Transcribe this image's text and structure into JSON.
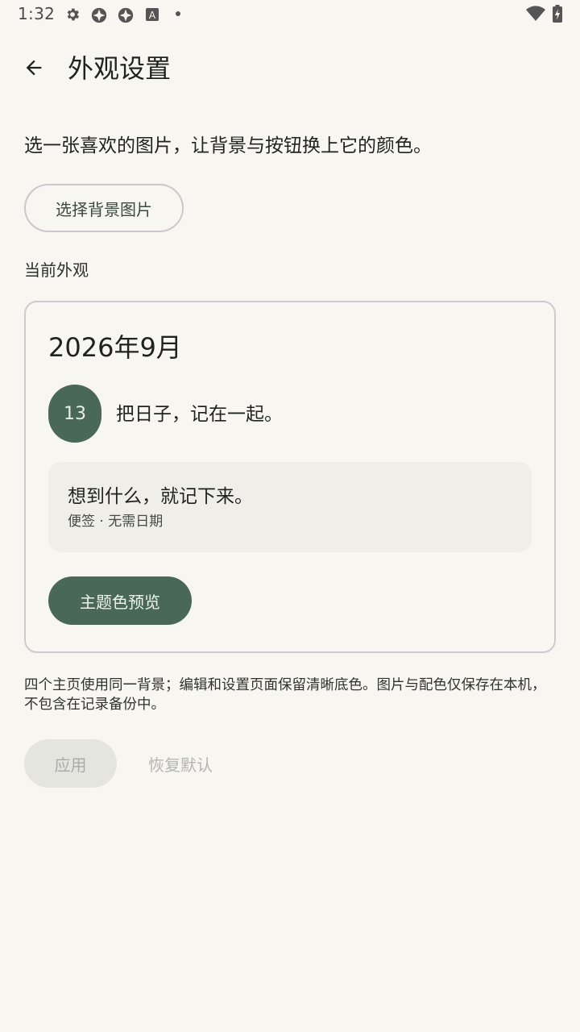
{
  "status_bar": {
    "time": "1:32",
    "icons": [
      "gear-icon",
      "app-icon",
      "app-icon",
      "keyboard-a-icon",
      "dot-icon",
      "wifi-icon",
      "battery-charging-icon"
    ]
  },
  "app_bar": {
    "title": "外观设置",
    "back_icon": "arrow-left-icon"
  },
  "description": "选一张喜欢的图片，让背景与按钮换上它的颜色。",
  "pick_image_button": "选择背景图片",
  "current_appearance_label": "当前外观",
  "preview": {
    "month": "2026年9月",
    "day_number": "13",
    "day_text": "把日子，记在一起。",
    "note_title": "想到什么，就记下来。",
    "note_subtitle": "便签 · 无需日期",
    "theme_button": "主题色预览"
  },
  "footnote": "四个主页使用同一背景；编辑和设置页面保留清晰底色。图片与配色仅保存在本机，不包含在记录备份中。",
  "actions": {
    "apply": "应用",
    "reset": "恢复默认"
  },
  "colors": {
    "background": "#f8f6f0",
    "accent": "#4a6856",
    "note_background": "#f0eee8",
    "disabled_button": "#e5e5df"
  }
}
